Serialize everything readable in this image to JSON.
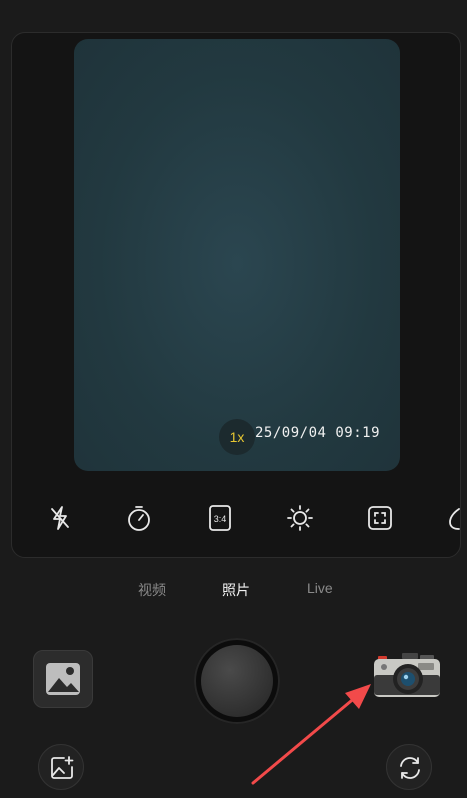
{
  "preview": {
    "zoom_label": "1x",
    "timestamp": "25/09/04 09:19"
  },
  "toolbar": {
    "icons": [
      "flash-off-icon",
      "timer-icon",
      "aspect-ratio-icon",
      "brightness-icon",
      "focus-frame-icon",
      "partial-icon"
    ],
    "aspect_label": "3:4"
  },
  "modes": {
    "video": "视频",
    "photo": "照片",
    "live": "Live",
    "active": "photo"
  },
  "colors": {
    "zoom_accent": "#e6c632",
    "arrow": "#f24a4a"
  }
}
